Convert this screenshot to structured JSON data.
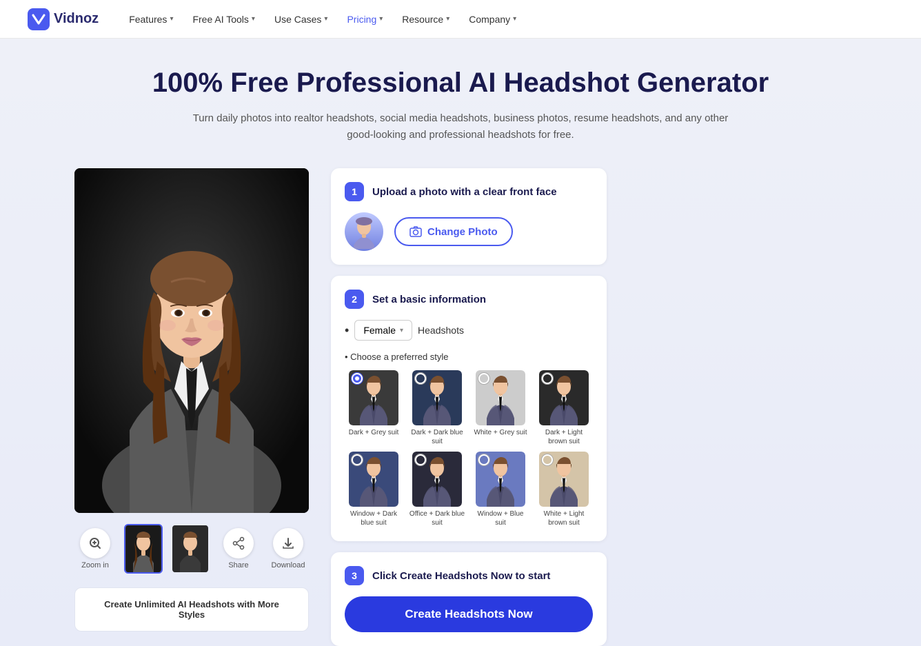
{
  "nav": {
    "logo_text": "Vidnoz",
    "items": [
      {
        "label": "Features",
        "has_dropdown": true
      },
      {
        "label": "Free AI Tools",
        "has_dropdown": true
      },
      {
        "label": "Use Cases",
        "has_dropdown": true
      },
      {
        "label": "Pricing",
        "has_dropdown": true
      },
      {
        "label": "Resource",
        "has_dropdown": true
      },
      {
        "label": "Company",
        "has_dropdown": true
      }
    ]
  },
  "hero": {
    "title": "100% Free Professional AI Headshot Generator",
    "subtitle": "Turn daily photos into realtor headshots, social media headshots, business photos, resume headshots, and any other good-looking and professional headshots for free."
  },
  "controls": {
    "step1": {
      "badge": "1",
      "title": "Upload a photo with a clear front face",
      "change_photo_btn": "Change Photo"
    },
    "step2": {
      "badge": "2",
      "title": "Set a basic information",
      "gender": "Female",
      "headshots_label": "Headshots",
      "style_section_label": "• Choose a preferred style",
      "styles": [
        {
          "name": "Dark + Grey suit",
          "selected": true,
          "bg": "suit-dark-grey"
        },
        {
          "name": "Dark + Dark blue suit",
          "selected": false,
          "bg": "suit-dark-blue"
        },
        {
          "name": "White + Grey suit",
          "selected": false,
          "bg": "suit-white-grey"
        },
        {
          "name": "Dark + Light brown suit",
          "selected": false,
          "bg": "suit-light-brown"
        },
        {
          "name": "Window + Dark blue suit",
          "selected": false,
          "bg": "suit-window-blue"
        },
        {
          "name": "Office + Dark blue suit",
          "selected": false,
          "bg": "suit-office-dark"
        },
        {
          "name": "Window + Blue suit",
          "selected": false,
          "bg": "suit-window-blue2"
        },
        {
          "name": "White + Light brown suit",
          "selected": false,
          "bg": "suit-white-light"
        }
      ]
    },
    "step3": {
      "badge": "3",
      "title": "Click Create Headshots Now to start",
      "create_btn": "Create Headshots Now"
    }
  },
  "preview": {
    "zoom_in_label": "Zoom in",
    "share_label": "Share",
    "download_label": "Download"
  },
  "bottom_banner": {
    "text": "Create Unlimited AI Headshots with More Styles"
  }
}
